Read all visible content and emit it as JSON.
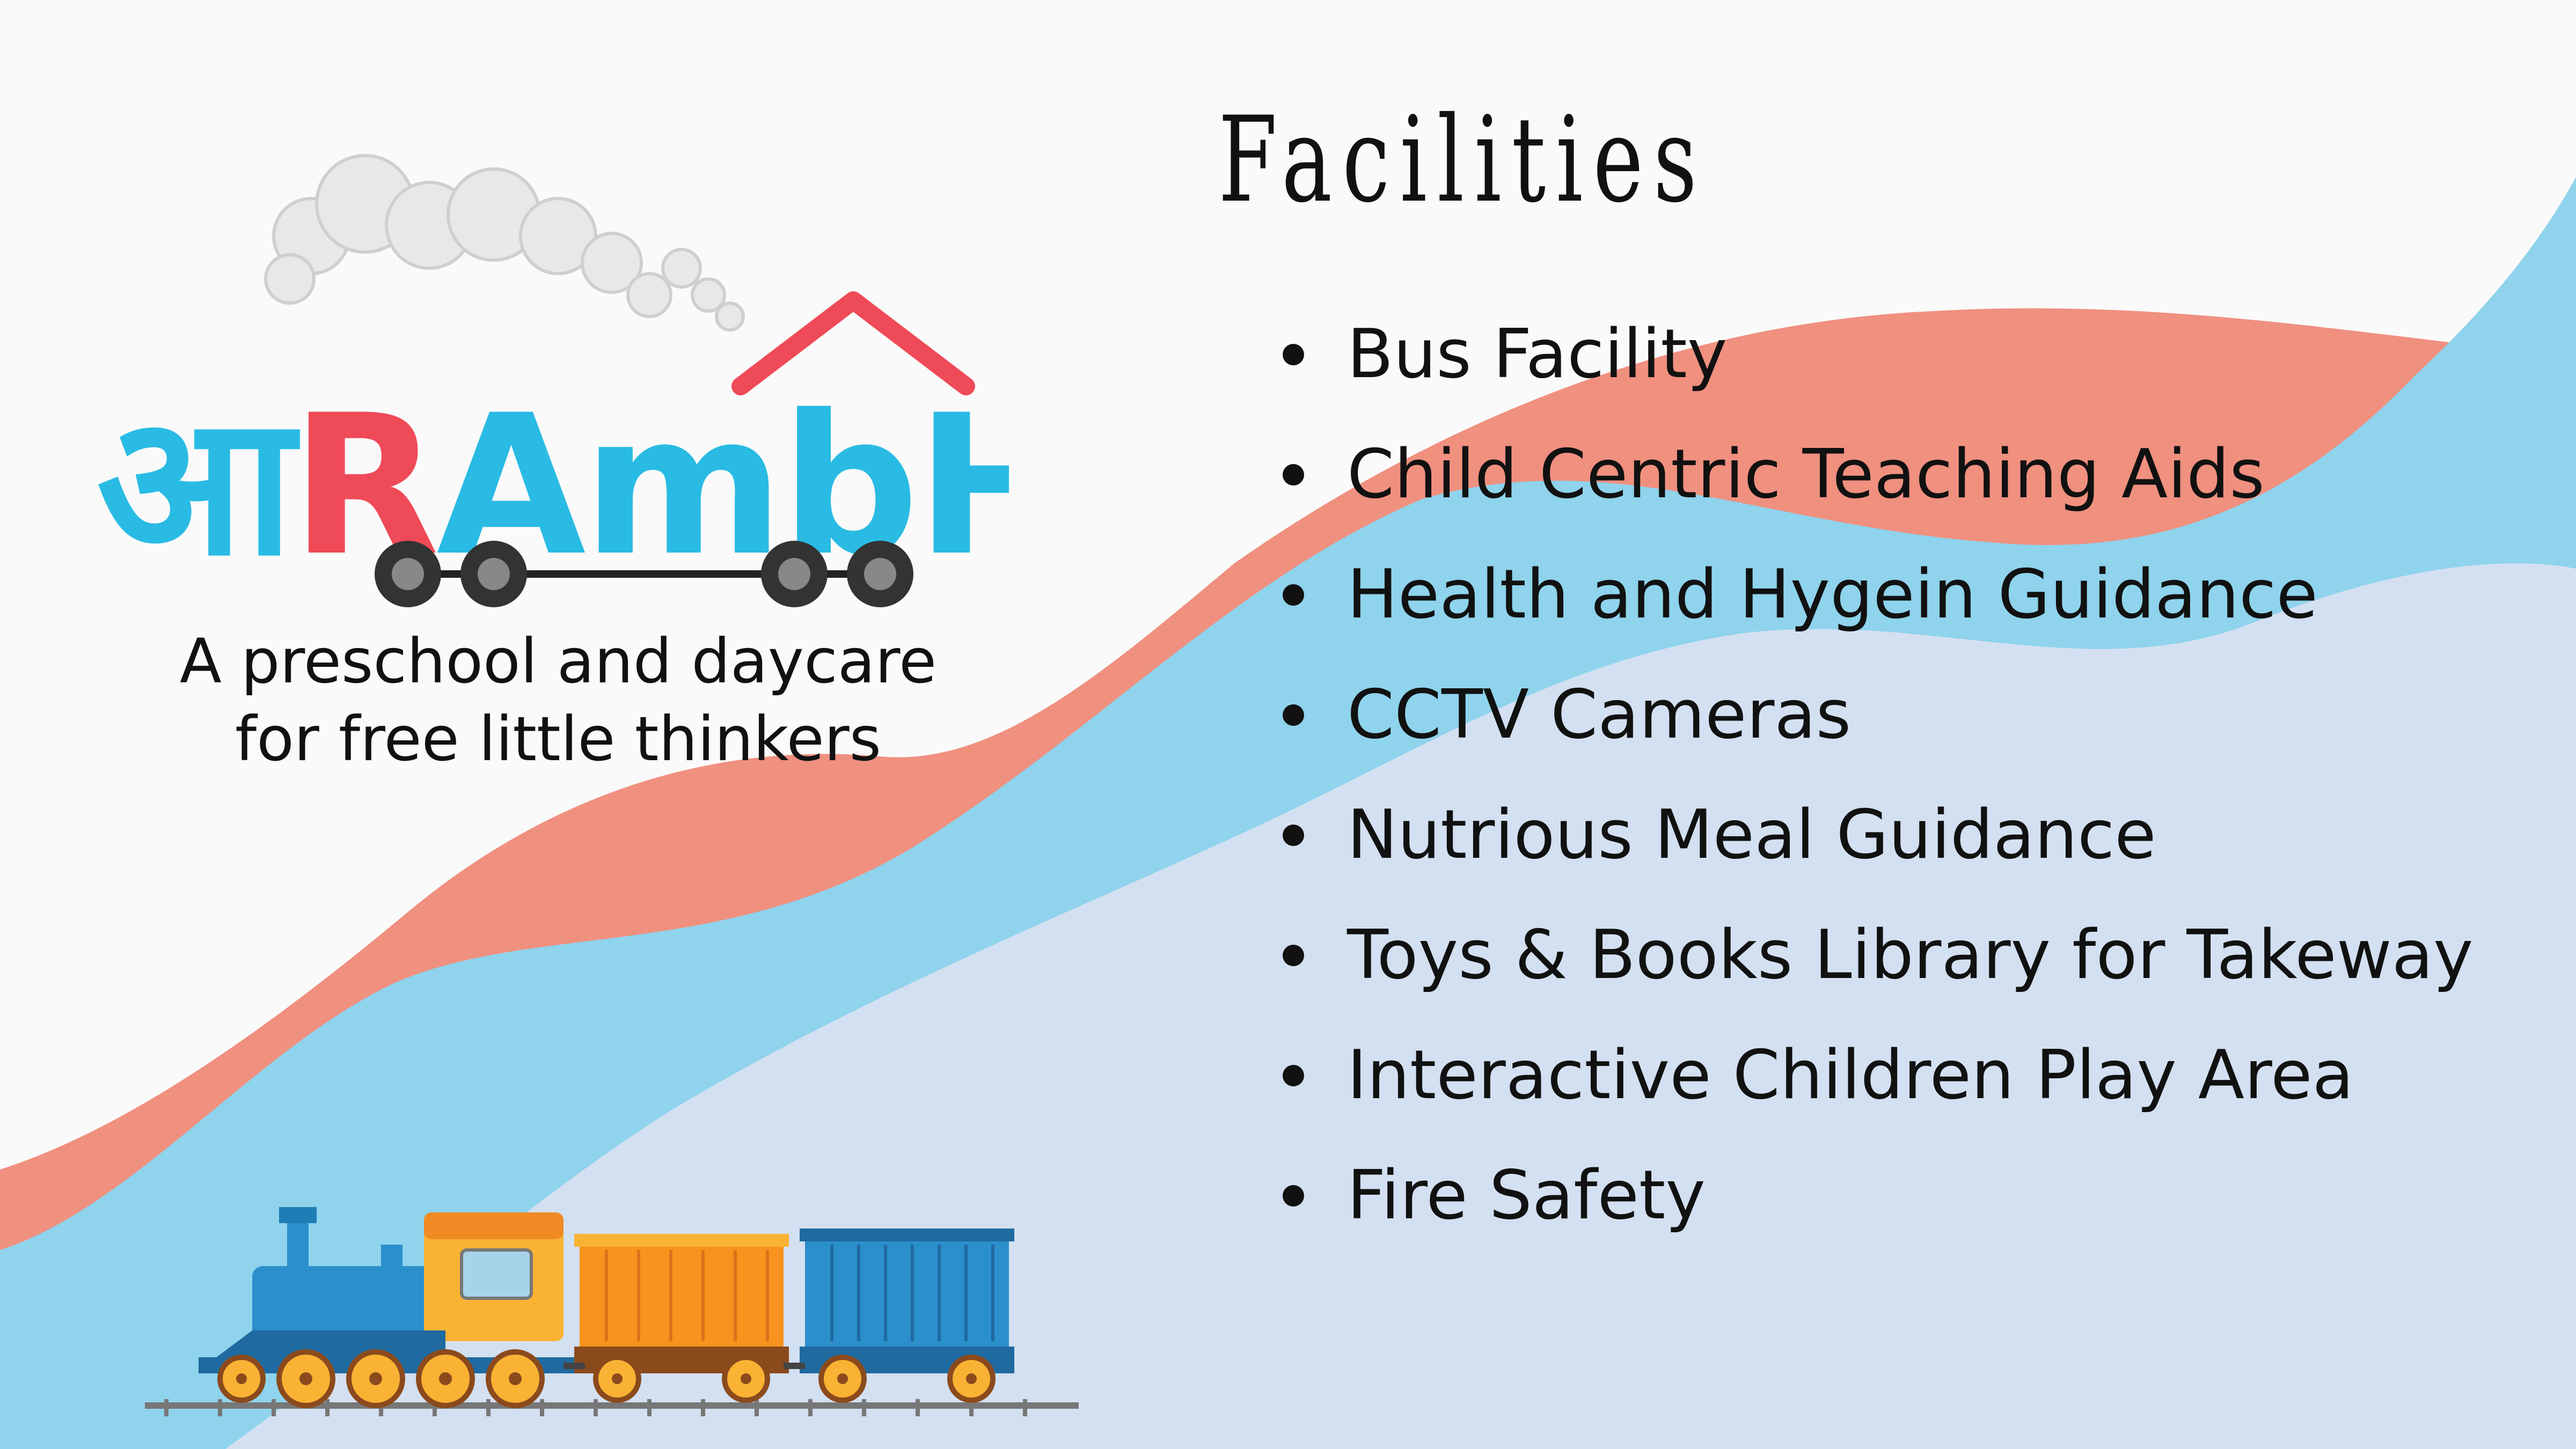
{
  "brand": {
    "logo_text": "आRAmbH",
    "tagline_line1": "A preschool and daycare",
    "tagline_line2": "for free little thinkers"
  },
  "slide": {
    "title": "Facilities"
  },
  "facilities": [
    "Bus Facility",
    "Child Centric Teaching Aids",
    "Health and Hygein Guidance",
    "CCTV Cameras",
    "Nutrious Meal Guidance",
    "Toys & Books Library for Takeway",
    "Interactive Children Play Area",
    "Fire Safety"
  ],
  "colors": {
    "background": "#fafafa",
    "coral_wave": "#f0907f",
    "blue_wave": "#8fd3ec",
    "pale_wave": "#d3e0f1",
    "logo_blue": "#29bbe4",
    "logo_red": "#ef4a57",
    "text": "#111111"
  },
  "icons": {
    "logo": "aarambh-logo-icon",
    "train": "toy-train-icon"
  }
}
